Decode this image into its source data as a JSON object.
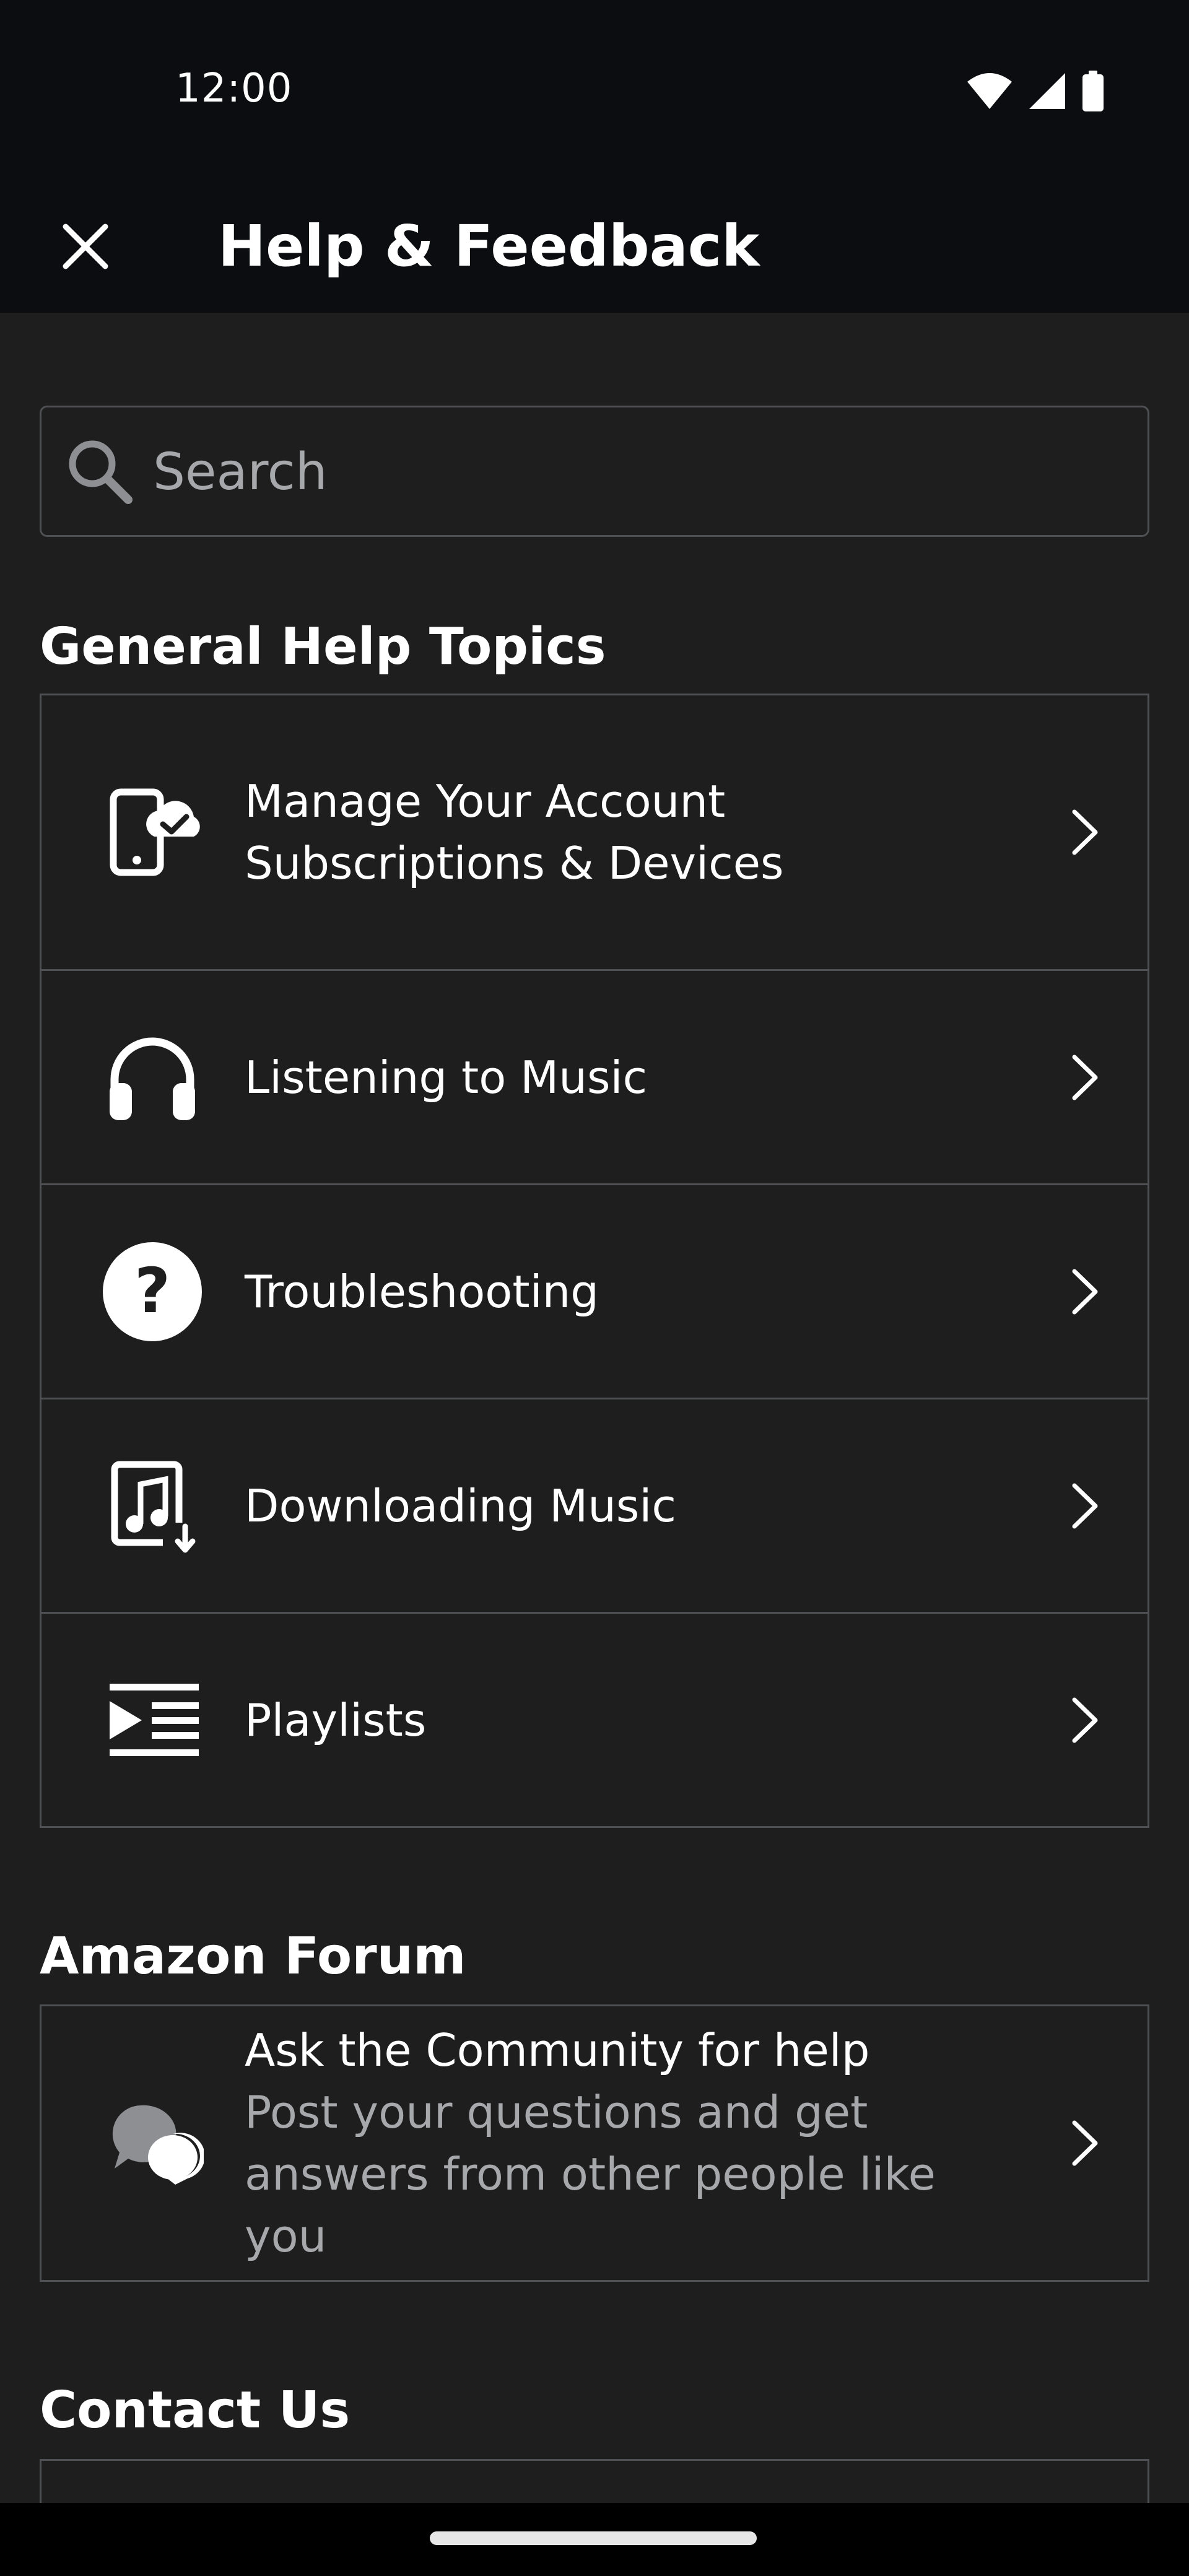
{
  "status_bar": {
    "time": "12:00"
  },
  "app_bar": {
    "title": "Help & Feedback",
    "close_icon": "close-icon"
  },
  "search": {
    "placeholder": "Search",
    "value": ""
  },
  "general_help": {
    "heading": "General Help Topics",
    "items": [
      {
        "icon": "phone-check-icon",
        "label": "Manage Your Account Subscriptions & Devices"
      },
      {
        "icon": "headphones-icon",
        "label": "Listening to Music"
      },
      {
        "icon": "question-circle-icon",
        "label": "Troubleshooting"
      },
      {
        "icon": "music-download-icon",
        "label": "Downloading Music"
      },
      {
        "icon": "playlist-icon",
        "label": "Playlists"
      }
    ]
  },
  "forum": {
    "heading": "Amazon Forum",
    "item": {
      "icon": "chat-bubbles-icon",
      "title": "Ask the Community for help",
      "subtitle": "Post your questions and get answers from other people like you"
    }
  },
  "contact": {
    "heading": "Contact Us"
  },
  "colors": {
    "background": "#1e1e1f",
    "bar": "#0c0d10",
    "border": "#4f5053",
    "text": "#ffffff",
    "secondary_text": "#a7a8ab"
  }
}
